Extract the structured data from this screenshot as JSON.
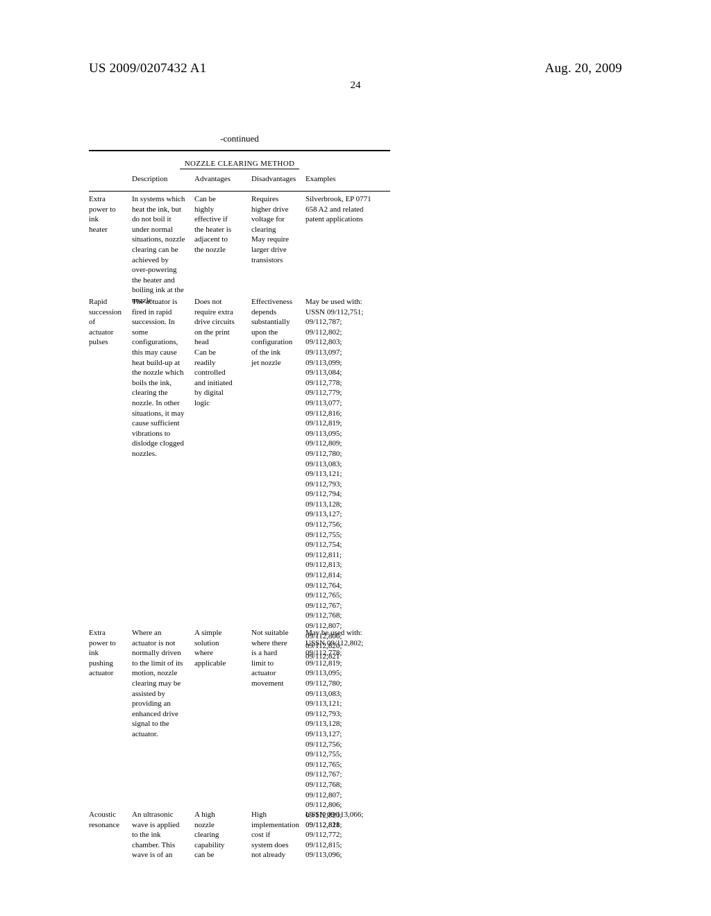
{
  "header": {
    "publication_number": "US 2009/0207432 A1",
    "publication_date": "Aug. 20, 2009",
    "page_number": "24"
  },
  "table": {
    "continued_label": "-continued",
    "group_title": "NOZZLE CLEARING METHOD",
    "columns": [
      {
        "key": "method",
        "label": ""
      },
      {
        "key": "description",
        "label": "Description"
      },
      {
        "key": "advantages",
        "label": "Advantages"
      },
      {
        "key": "disadvantages",
        "label": "Disadvantages"
      },
      {
        "key": "examples",
        "label": "Examples"
      }
    ],
    "rows": [
      {
        "method": "Extra\npower to\nink\nheater",
        "description": "In systems which\nheat the ink, but\ndo not boil it\nunder normal\nsituations, nozzle\nclearing can be\nachieved by\nover-powering\nthe heater and\nboiling ink at the\nnozzle.",
        "advantages": "Can be\nhighly\neffective if\nthe heater is\nadjacent to\nthe nozzle",
        "disadvantages": "Requires\nhigher drive\nvoltage for\nclearing\nMay require\nlarger drive\ntransistors",
        "examples": "Silverbrook, EP 0771\n658 A2 and related\npatent applications"
      },
      {
        "method": "Rapid\nsuccession\nof\nactuator\npulses",
        "description": "The actuator is\nfired in rapid\nsuccession. In\nsome\nconfigurations,\nthis may cause\nheat build-up at\nthe nozzle which\nboils the ink,\nclearing the\nnozzle. In other\nsituations, it may\ncause sufficient\nvibrations to\ndislodge clogged\nnozzles.",
        "advantages": "Does not\nrequire extra\ndrive circuits\non the print\nhead\nCan be\nreadily\ncontrolled\nand initiated\nby digital\nlogic",
        "disadvantages": "Effectiveness\ndepends\nsubstantially\nupon the\nconfiguration\nof the ink\njet nozzle",
        "examples": "May be used with:\nUSSN 09/112,751;\n09/112,787;\n09/112,802;\n09/112,803;\n09/113,097;\n09/113,099;\n09/113,084;\n09/112,778;\n09/112,779;\n09/113,077;\n09/112,816;\n09/112,819;\n09/113,095;\n09/112,809;\n09/112,780;\n09/113,083;\n09/113,121;\n09/112,793;\n09/112,794;\n09/113,128;\n09/113,127;\n09/112,756;\n09/112,755;\n09/112,754;\n09/112,811;\n09/112,813;\n09/112,814;\n09/112,764;\n09/112,765;\n09/112,767;\n09/112,768;\n09/112,807;\n09/112,806;\n09/112,820;\n09/112,821"
      },
      {
        "method": "Extra\npower to\nink\npushing\nactuator",
        "description": "Where an\nactuator is not\nnormally driven\nto the limit of its\nmotion, nozzle\nclearing may be\nassisted by\nproviding an\nenhanced drive\nsignal to the\nactuator.",
        "advantages": "A simple\nsolution\nwhere\napplicable",
        "disadvantages": "Not suitable\nwhere there\nis a hard\nlimit to\nactuator\nmovement",
        "examples": "May be used with:\nUSSN 09/112,802;\n09/112,778;\n09/112,819;\n09/113,095;\n09/112,780;\n09/113,083;\n09/113,121;\n09/112,793;\n09/113,128;\n09/113,127;\n09/112,756;\n09/112,755;\n09/112,765;\n09/112,767;\n09/112,768;\n09/112,807;\n09/112,806;\n09/112,820;\n09/112,821"
      },
      {
        "method": "Acoustic\nresonance",
        "description": "An ultrasonic\nwave is applied\nto the ink\nchamber. This\nwave is of an",
        "advantages": "A high\nnozzle\nclearing\ncapability\ncan be",
        "disadvantages": "High\nimplementation\ncost if\nsystem does\nnot already",
        "examples": "USSN 09/113,066;\n09/112,818;\n09/112,772;\n09/112,815;\n09/113,096;"
      }
    ]
  }
}
